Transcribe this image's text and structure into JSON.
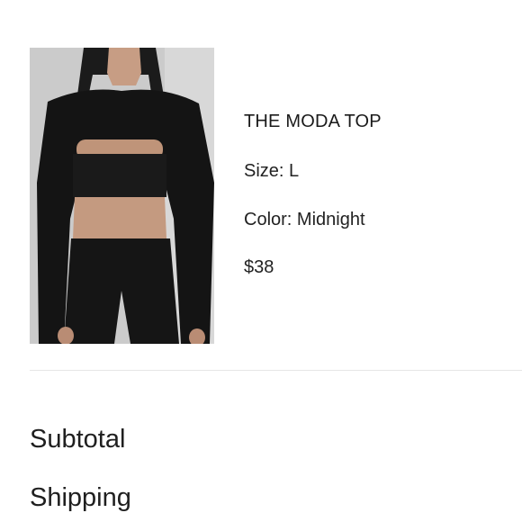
{
  "product": {
    "name": "THE MODA TOP",
    "size_text": "Size: L",
    "color_text": "Color: Midnight",
    "price": "$38"
  },
  "summary": {
    "subtotal_label": "Subtotal",
    "shipping_label": "Shipping"
  },
  "colors": {
    "text": "#1a1a1a",
    "divider": "#e6e6e6",
    "product_garment": "#151515",
    "background_photo": "#cfcfcf"
  }
}
